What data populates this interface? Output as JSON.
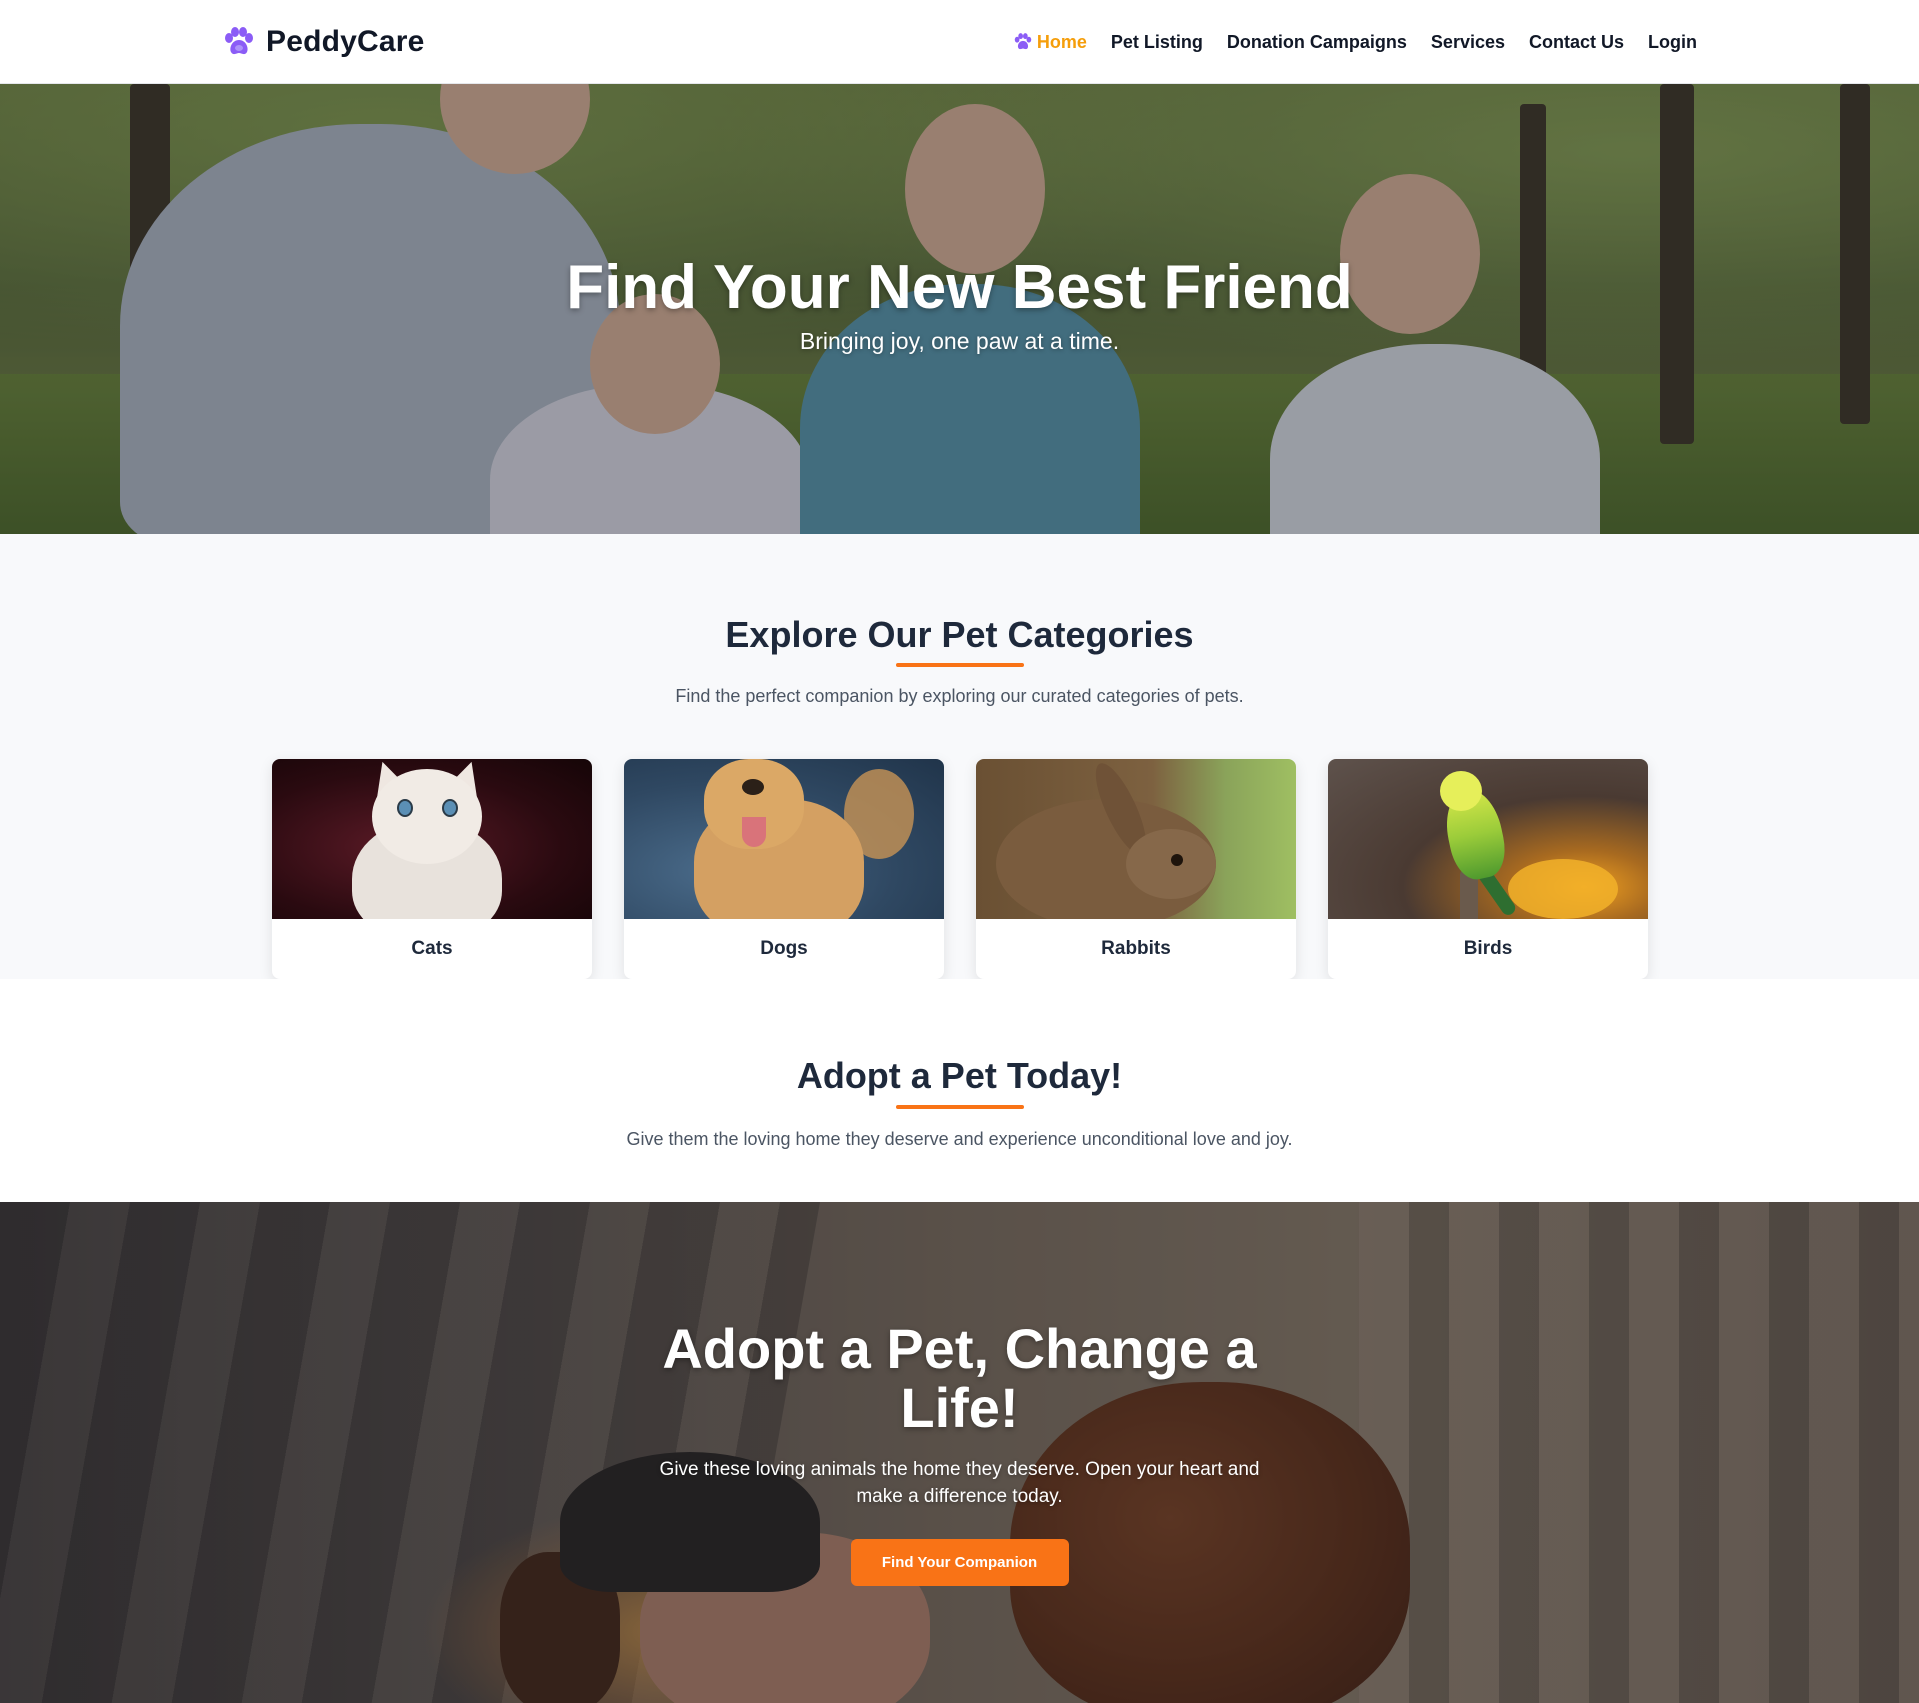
{
  "navbar": {
    "brand": "PeddyCare",
    "links": [
      {
        "label": "Home",
        "active": true
      },
      {
        "label": "Pet Listing",
        "active": false
      },
      {
        "label": "Donation Campaigns",
        "active": false
      },
      {
        "label": "Services",
        "active": false
      },
      {
        "label": "Contact Us",
        "active": false
      },
      {
        "label": "Login",
        "active": false
      }
    ]
  },
  "hero": {
    "title": "Find Your New Best Friend",
    "subtitle": "Bringing joy, one paw at a time."
  },
  "categories": {
    "title": "Explore Our Pet Categories",
    "subtitle": "Find the perfect companion by exploring our curated categories of pets.",
    "items": [
      {
        "label": "Cats",
        "image": "cat-photo"
      },
      {
        "label": "Dogs",
        "image": "dog-photo"
      },
      {
        "label": "Rabbits",
        "image": "rabbit-photo"
      },
      {
        "label": "Birds",
        "image": "bird-photo"
      }
    ]
  },
  "adopt_today": {
    "title": "Adopt a Pet Today!",
    "subtitle": "Give them the loving home they deserve and experience unconditional love and joy."
  },
  "cta": {
    "title": "Adopt a Pet, Change a Life!",
    "text": "Give these loving animals the home they deserve. Open your heart and make a difference today.",
    "button": "Find Your Companion"
  },
  "colors": {
    "accent": "#f97316",
    "active_nav": "#f59e0b",
    "logo_paw": "#8b5cf6",
    "heading": "#1e293b"
  },
  "icons": {
    "logo": "paw-icon",
    "active_nav_marker": "paw-icon"
  }
}
